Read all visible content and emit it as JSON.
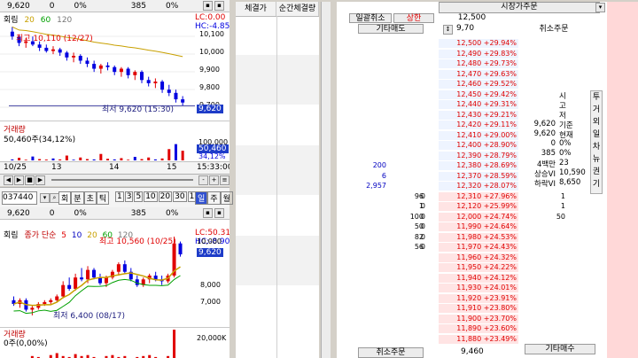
{
  "chart1": {
    "top_bar": {
      "price": "9,620",
      "change": "0",
      "pct": "0%",
      "volume": "385",
      "rate": "0%"
    },
    "title_main": "회림",
    "ma_labels": [
      "20",
      "60",
      "120"
    ],
    "lc": "LC:0.00",
    "hc": "HC:-4.85",
    "high_label": "최고 10,110 (12/27)",
    "low_label": "최저 9,620 (15:30)",
    "y_ticks": [
      "10,100",
      "10,000",
      "9,900",
      "9,800",
      "9,700"
    ],
    "price_tag": "9,620",
    "vol_title": "거래량",
    "vol_sub": "50,460주(34,12%)",
    "vol_ticks": [
      "100,000",
      "50,460",
      "34,12%"
    ],
    "x_ticks": [
      "10/25",
      "13",
      "14",
      "15",
      "15:33:00"
    ],
    "candles": [
      [
        10080,
        10110,
        10030,
        10050
      ],
      [
        10050,
        10060,
        9990,
        10010
      ],
      [
        10010,
        10040,
        9980,
        10020
      ],
      [
        10020,
        10050,
        9990,
        10000
      ],
      [
        10000,
        10020,
        9960,
        9980
      ],
      [
        9980,
        10000,
        9950,
        9960
      ],
      [
        9960,
        9990,
        9940,
        9970
      ],
      [
        9970,
        9980,
        9930,
        9950
      ],
      [
        9950,
        9960,
        9900,
        9920
      ],
      [
        9920,
        9950,
        9890,
        9930
      ],
      [
        9930,
        9940,
        9880,
        9900
      ],
      [
        9900,
        9920,
        9860,
        9880
      ],
      [
        9880,
        9900,
        9830,
        9850
      ],
      [
        9850,
        9880,
        9820,
        9870
      ],
      [
        9870,
        9890,
        9840,
        9860
      ],
      [
        9860,
        9870,
        9810,
        9830
      ],
      [
        9830,
        9860,
        9800,
        9850
      ],
      [
        9850,
        9860,
        9790,
        9810
      ],
      [
        9810,
        9840,
        9780,
        9830
      ],
      [
        9830,
        9840,
        9760,
        9780
      ],
      [
        9780,
        9800,
        9740,
        9760
      ],
      [
        9760,
        9790,
        9730,
        9770
      ],
      [
        9770,
        9780,
        9700,
        9720
      ],
      [
        9720,
        9750,
        9680,
        9700
      ],
      [
        9700,
        9720,
        9640,
        9660
      ],
      [
        9660,
        9680,
        9620,
        9640
      ]
    ],
    "volumes": [
      3000,
      8000,
      2000,
      12000,
      4000,
      2500,
      6000,
      3000,
      15000,
      2000,
      9000,
      4000,
      3000,
      20000,
      5000,
      3000,
      7000,
      2000,
      11000,
      4000,
      9000,
      3000,
      6000,
      35000,
      50460,
      30000
    ],
    "vol_max": 110000,
    "price_range": [
      9600,
      10150
    ]
  },
  "toolbar": {
    "code": "037440",
    "tabs": [
      "회",
      "분",
      "초",
      "틱"
    ],
    "periods": [
      "1",
      "3",
      "5",
      "10",
      "20",
      "30",
      "1"
    ],
    "right_tabs": [
      "일",
      "주",
      "월"
    ]
  },
  "chart2": {
    "top_bar": {
      "price": "9,620",
      "change": "0",
      "pct": "0%",
      "volume": "385",
      "rate": "0%"
    },
    "title_main": "회림",
    "ma_title": "종가 단순",
    "ma_labels": [
      "5",
      "10",
      "20",
      "60",
      "120"
    ],
    "lc": "LC:50.31",
    "hc": "HC:-8.90",
    "high_label": "최고 10,560 (10/25)",
    "low_label": "최저 6,400 (08/17)",
    "y_ticks": [
      "10,000",
      "9,620",
      "8,000",
      "7,000"
    ],
    "price_tag": "9,620",
    "vol_title": "거래량",
    "vol_sub": "0주(0,00%)",
    "vol_ticks": [
      "20,000K"
    ],
    "candles": [
      [
        7200,
        7400,
        6900,
        7000
      ],
      [
        7000,
        7300,
        6800,
        7200
      ],
      [
        7200,
        7300,
        6600,
        6700
      ],
      [
        6700,
        6900,
        6400,
        6800
      ],
      [
        6800,
        7100,
        6700,
        7000
      ],
      [
        7000,
        7200,
        6900,
        7100
      ],
      [
        7100,
        7300,
        7000,
        7200
      ],
      [
        7200,
        7500,
        7100,
        7400
      ],
      [
        7400,
        8200,
        7300,
        8000
      ],
      [
        8000,
        8400,
        7700,
        7800
      ],
      [
        7800,
        8600,
        7700,
        8400
      ],
      [
        8400,
        8900,
        8200,
        8300
      ],
      [
        8300,
        9000,
        8100,
        8800
      ],
      [
        8800,
        8900,
        8300,
        8400
      ],
      [
        8400,
        8600,
        8000,
        8100
      ],
      [
        8100,
        8500,
        7900,
        8400
      ],
      [
        8400,
        8800,
        8300,
        8700
      ],
      [
        8700,
        9200,
        8500,
        9100
      ],
      [
        9100,
        9300,
        8600,
        8700
      ],
      [
        8700,
        8900,
        8200,
        8300
      ],
      [
        8300,
        8500,
        7900,
        8000
      ],
      [
        8000,
        8400,
        7900,
        8300
      ],
      [
        8300,
        8600,
        8100,
        8500
      ],
      [
        8500,
        8700,
        8200,
        8300
      ],
      [
        8300,
        8500,
        8000,
        8200
      ],
      [
        8200,
        8600,
        8100,
        8500
      ],
      [
        8500,
        10560,
        8400,
        10200
      ],
      [
        10200,
        10300,
        9500,
        9620
      ]
    ],
    "price_range": [
      6300,
      10700
    ]
  },
  "mid": {
    "col1": "체결가",
    "col2": "순간체결량"
  },
  "orderbook": {
    "title": "시장가주문",
    "top_btns": [
      "일괄취소",
      "상한"
    ],
    "top_price": "12,500",
    "other_sell": "기타매도",
    "sub_price": "9,70",
    "cancel_order": "취소주문",
    "rows": [
      {
        "price": "12,500",
        "pct": "+29.94%"
      },
      {
        "price": "12,490",
        "pct": "+29.83%"
      },
      {
        "price": "12,480",
        "pct": "+29.73%"
      },
      {
        "price": "12,470",
        "pct": "+29.63%"
      },
      {
        "price": "12,460",
        "pct": "+29.52%"
      },
      {
        "price": "12,450",
        "pct": "+29.42%"
      },
      {
        "price": "12,440",
        "pct": "+29.31%"
      },
      {
        "price": "12,430",
        "pct": "+29.21%"
      },
      {
        "price": "12,420",
        "pct": "+29.11%"
      },
      {
        "price": "12,410",
        "pct": "+29.00%"
      },
      {
        "price": "12,400",
        "pct": "+28.90%"
      },
      {
        "price": "12,390",
        "pct": "+28.79%"
      },
      {
        "price": "12,380",
        "pct": "+28.69%",
        "qty": "200"
      },
      {
        "price": "12,370",
        "pct": "+28.59%",
        "qty": "6"
      },
      {
        "price": "12,320",
        "pct": "+28.07%",
        "qty": "2,957"
      },
      {
        "price": "12,310",
        "pct": "+27.96%",
        "bq": "96",
        "bq2": "0",
        "rq": "1"
      },
      {
        "price": "12,120",
        "pct": "+25.99%",
        "bq": "1",
        "bq2": "0",
        "rq": "1"
      },
      {
        "price": "12,000",
        "pct": "+24.74%",
        "bq": "100",
        "bq2": "0",
        "rq": "50"
      },
      {
        "price": "11,990",
        "pct": "+24.64%",
        "bq": "50",
        "bq2": "0"
      },
      {
        "price": "11,980",
        "pct": "+24.53%",
        "bq": "82",
        "bq2": "0"
      },
      {
        "price": "11,970",
        "pct": "+24.43%",
        "bq": "56",
        "bq2": "0"
      },
      {
        "price": "11,960",
        "pct": "+24.32%"
      },
      {
        "price": "11,950",
        "pct": "+24.22%"
      },
      {
        "price": "11,940",
        "pct": "+24.12%"
      },
      {
        "price": "11,930",
        "pct": "+24.01%"
      },
      {
        "price": "11,920",
        "pct": "+23.91%"
      },
      {
        "price": "11,910",
        "pct": "+23.80%"
      },
      {
        "price": "11,900",
        "pct": "+23.70%"
      },
      {
        "price": "11,890",
        "pct": "+23.60%"
      },
      {
        "price": "11,880",
        "pct": "+23.49%"
      }
    ],
    "info": [
      {
        "k": "시",
        "v": ""
      },
      {
        "k": "고",
        "v": ""
      },
      {
        "k": "저",
        "v": ""
      },
      {
        "k": "기준",
        "v": "9,620"
      },
      {
        "k": "현재",
        "v": "9,620"
      },
      {
        "k": "0%",
        "v": "0"
      },
      {
        "k": "0%",
        "v": "385"
      },
      {
        "k": "23",
        "v": "4백만"
      },
      {
        "k": "10,590",
        "v": "상승VI"
      },
      {
        "k": "8,650",
        "v": "하락VI"
      }
    ],
    "side_tabs": [
      "투",
      "거",
      "외",
      "일",
      "차",
      "뉴",
      "권",
      "기"
    ],
    "bottom_cancel": "취소주문",
    "bottom_price": "9,460",
    "bottom_other": "기타매수"
  }
}
